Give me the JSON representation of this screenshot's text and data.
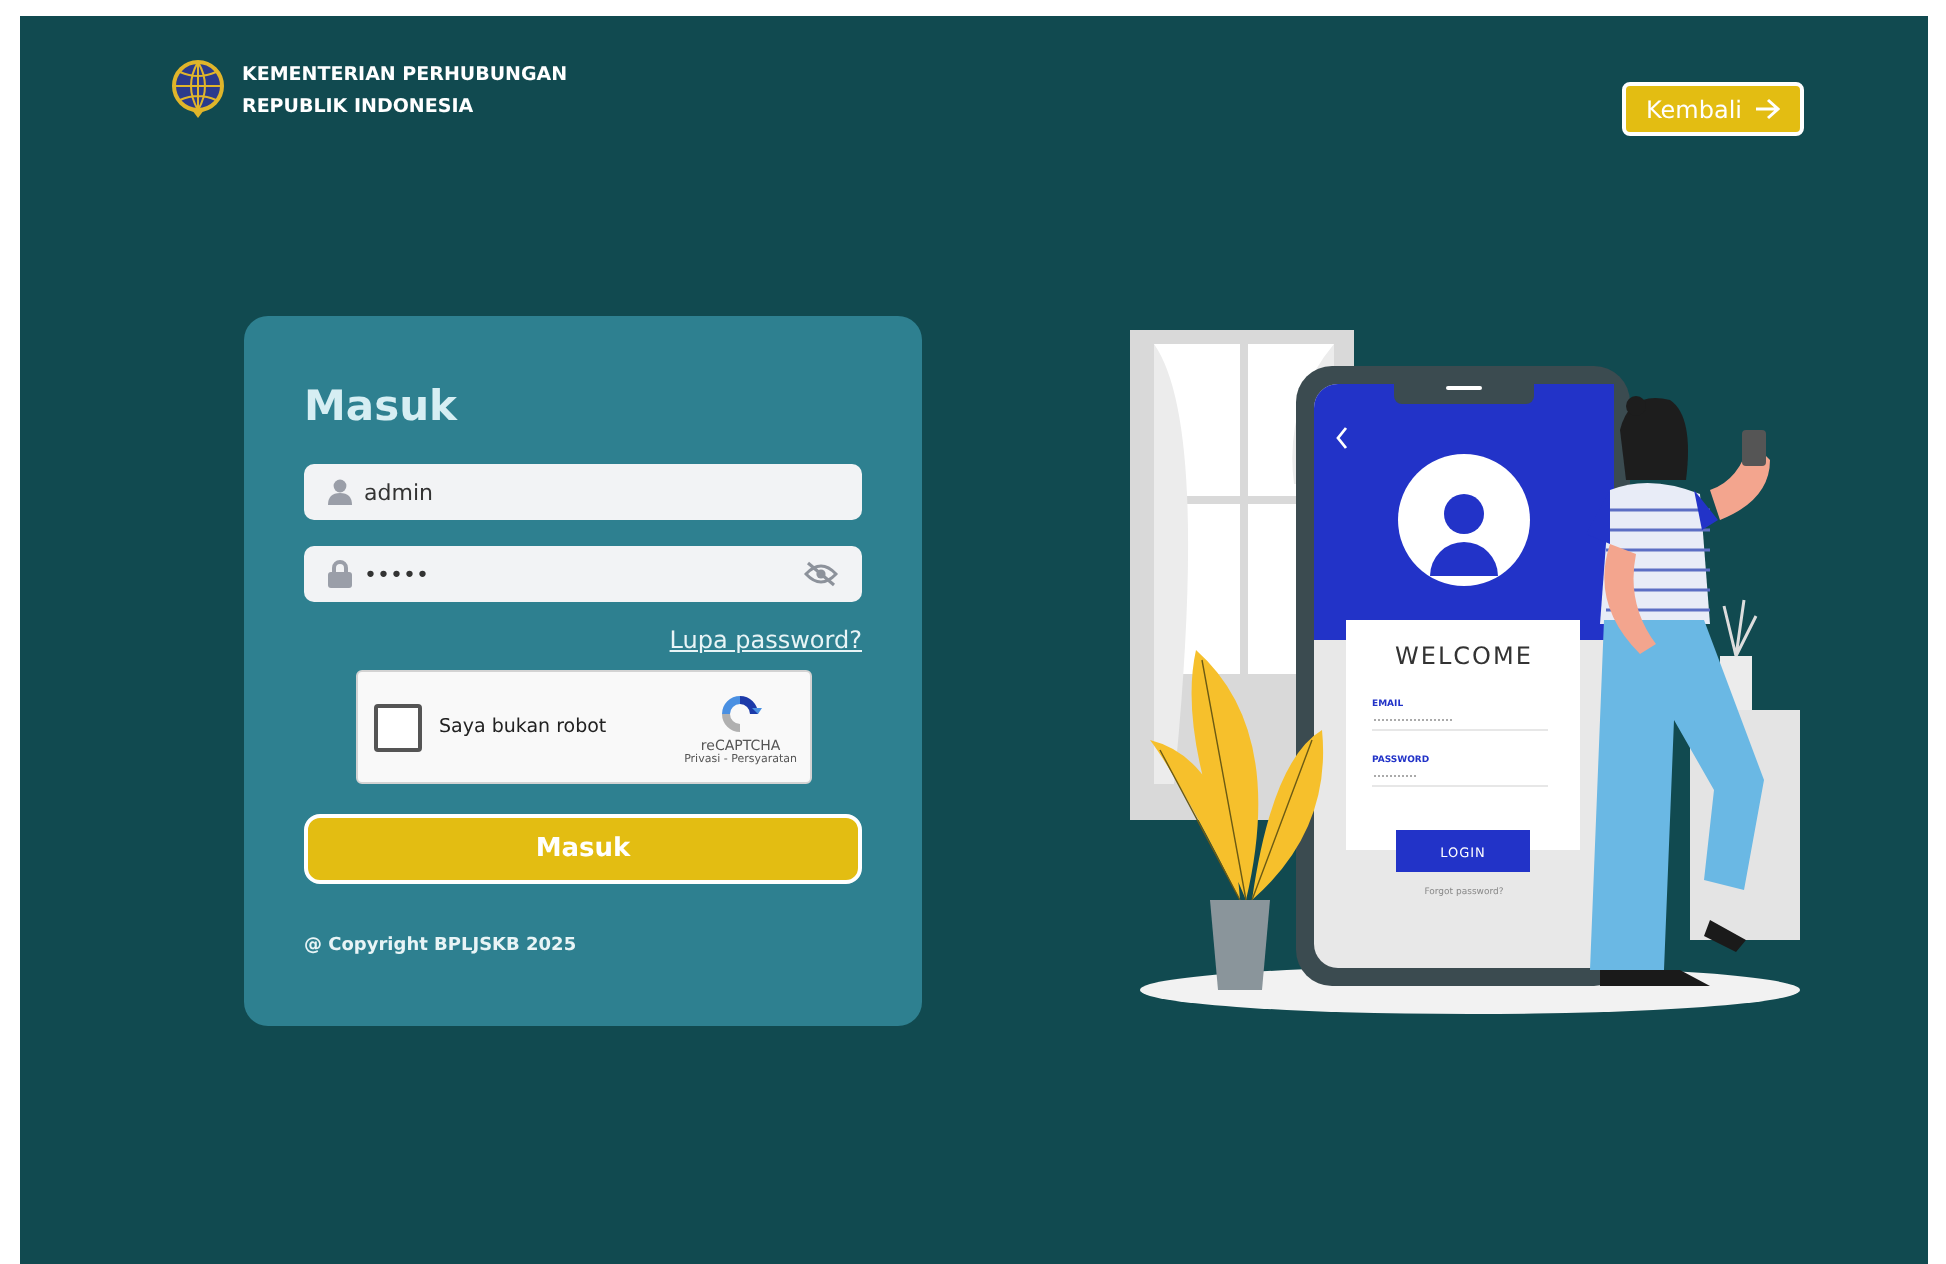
{
  "header": {
    "org_lines": [
      "KEMENTERIAN PERHUBUNGAN",
      "REPUBLIK INDONESIA"
    ],
    "back_button": "Kembali"
  },
  "login": {
    "title": "Masuk",
    "username": {
      "value": "admin"
    },
    "password": {
      "value": "•••••",
      "visible": false
    },
    "forgot_link": "Lupa password?",
    "captcha": {
      "label": "Saya bukan robot",
      "checked": false,
      "brand": "reCAPTCHA",
      "terms": "Privasi - Persyaratan"
    },
    "submit": "Masuk",
    "copyright": "@ Copyright BPLJSKB 2025"
  },
  "illustration": {
    "heading": "WELCOME",
    "email_label": "EMAIL",
    "password_label": "PASSWORD",
    "button": "LOGIN",
    "forgot": "Forgot password?"
  }
}
